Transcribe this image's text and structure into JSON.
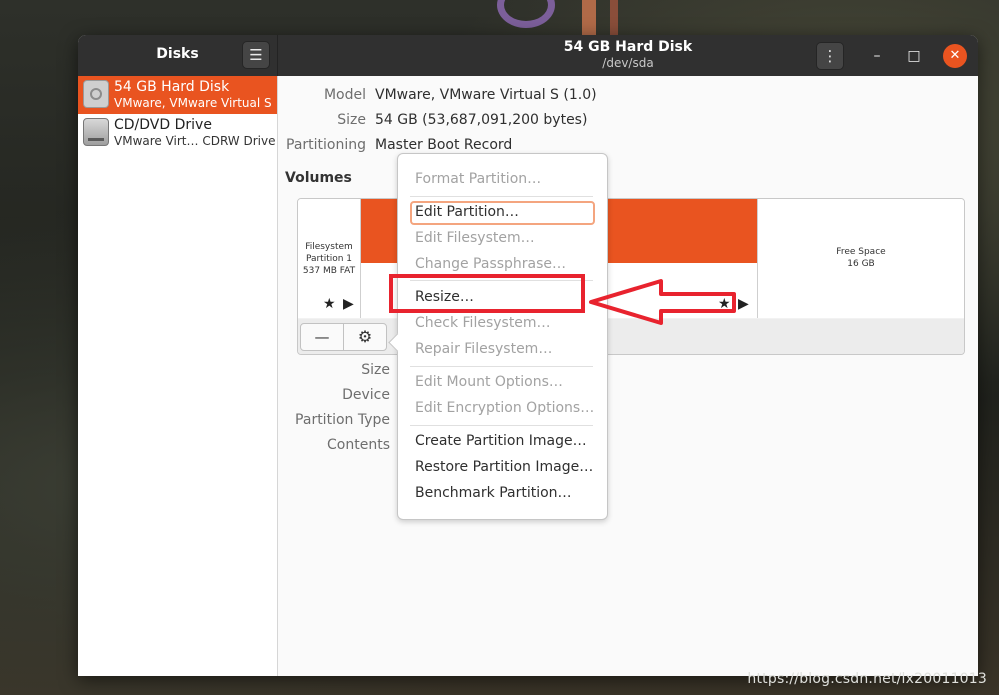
{
  "sidebar_title": "Disks",
  "header": {
    "title": "54 GB Hard Disk",
    "subtitle": "/dev/sda"
  },
  "disks": [
    {
      "name": "54 GB Hard Disk",
      "sub": "VMware, VMware Virtual S",
      "icon": "hard-disk-icon",
      "selected": true
    },
    {
      "name": "CD/DVD Drive",
      "sub": "VMware Virt… CDRW Drive",
      "icon": "optical-drive-icon",
      "selected": false
    }
  ],
  "disk_props": [
    {
      "label": "Model",
      "value": "VMware, VMware Virtual S (1.0)"
    },
    {
      "label": "Size",
      "value": "54 GB (53,687,091,200 bytes)"
    },
    {
      "label": "Partitioning",
      "value": "Master Boot Record"
    }
  ],
  "volumes": {
    "title": "Volumes",
    "partition1": {
      "line1": "Filesystem",
      "line2": "Partition 1",
      "line3": "537 MB FAT"
    },
    "free": {
      "line1": "Free Space",
      "line2": "16 GB"
    }
  },
  "detail_labels": [
    "Size",
    "Device",
    "Partition Type",
    "Contents"
  ],
  "menu": {
    "items": [
      {
        "label": "Format Partition…",
        "enabled": false
      },
      {
        "label": "Edit Partition…",
        "enabled": true
      },
      {
        "label": "Edit Filesystem…",
        "enabled": false
      },
      {
        "label": "Change Passphrase…",
        "enabled": false
      },
      {
        "label": "Resize…",
        "enabled": true
      },
      {
        "label": "Check Filesystem…",
        "enabled": false
      },
      {
        "label": "Repair Filesystem…",
        "enabled": false
      },
      {
        "label": "Edit Mount Options…",
        "enabled": false
      },
      {
        "label": "Edit Encryption Options…",
        "enabled": false
      },
      {
        "label": "Create Partition Image…",
        "enabled": true
      },
      {
        "label": "Restore Partition Image…",
        "enabled": true
      },
      {
        "label": "Benchmark Partition…",
        "enabled": true
      }
    ]
  },
  "watermark": "https://blog.csdn.net/lx20011013",
  "colors": {
    "accent": "#e95420",
    "headerbar": "#303030",
    "annotation": "#e8232e"
  }
}
